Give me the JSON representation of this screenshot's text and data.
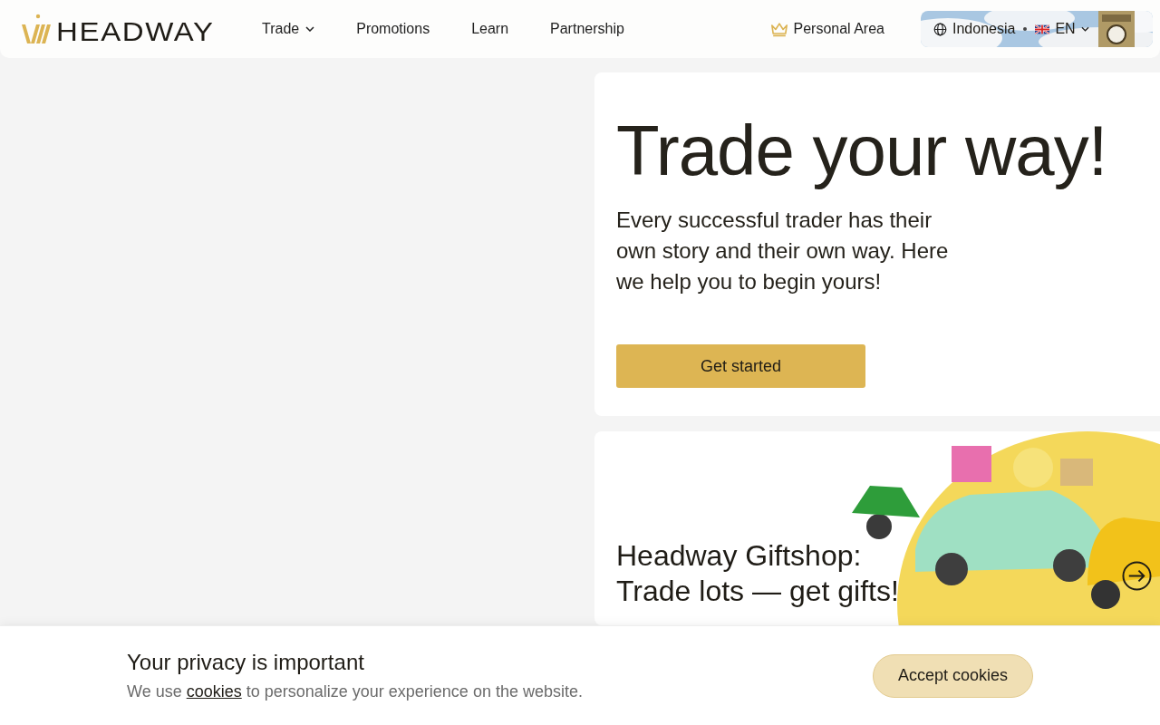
{
  "header": {
    "logo": "HEADWAY",
    "nav": [
      {
        "label": "Trade",
        "dropdown": true
      },
      {
        "label": "Promotions",
        "dropdown": false
      },
      {
        "label": "Learn",
        "dropdown": false
      },
      {
        "label": "Partnership",
        "dropdown": false
      }
    ],
    "personal_area": "Personal Area",
    "region": "Indonesia",
    "language": "EN"
  },
  "hero": {
    "title": "Trade your way!",
    "text": "Every successful trader has their own story and their own way. Here we help you to begin yours!",
    "button": "Get started"
  },
  "promo": {
    "title": "Headway Giftshop:\nTrade lots — get gifts!"
  },
  "cookie_bar": {
    "title": "Your privacy is important",
    "text_before": "We use",
    "link": "cookies",
    "text_after": "to personalize your experience on the website.",
    "button": "Accept cookies"
  }
}
